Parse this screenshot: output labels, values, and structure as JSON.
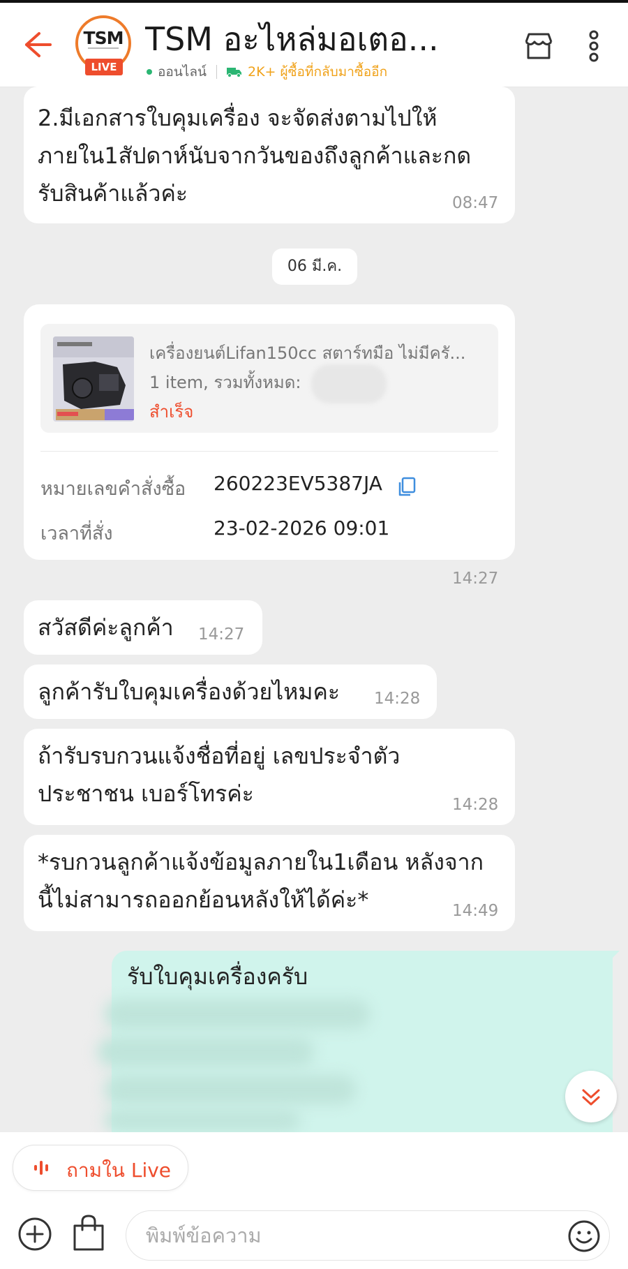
{
  "header": {
    "back_icon": "back-arrow-icon",
    "logo_text": "TSM",
    "live_badge": "LIVE",
    "shop_name": "TSM อะไหล่มอเตอ...",
    "online_status": "ออนไลน์",
    "returning_buyers": "2K+ ผู้ซื้อที่กลับมาซื้ออีก",
    "store_icon": "store-icon",
    "more_icon": "more-vertical-icon"
  },
  "messages": {
    "first": {
      "text": "2.มีเอกสารใบคุมเครื่อง จะจัดส่งตามไปให้\nภายใน1สัปดาห์นับจากวันของถึงลูกค้าและกด\nรับสินค้าแล้วค่ะ",
      "time": "08:47"
    },
    "date_separator": "06 มี.ค.",
    "order_card": {
      "product_name": "เครื่องยนต์Lifan150cc สตาร์ทมือ ไม่มีครั...",
      "items_total": "1 item, รวมทั้งหมด:",
      "status": "สำเร็จ",
      "order_no_label": "หมายเลขคำสั่งซื้อ",
      "order_no": "260223EV5387JA",
      "order_time_label": "เวลาที่สั่ง",
      "order_time": "23-02-2026 09:01",
      "time": "14:27"
    },
    "incoming": [
      {
        "text": "สวัสดีค่ะลูกค้า",
        "time": "14:27"
      },
      {
        "text": "ลูกค้ารับใบคุมเครื่องด้วยไหมคะ",
        "time": "14:28"
      },
      {
        "text": "ถ้ารับรบกวนแจ้งชื่อที่อยู่ เลขประจำตัว\nประชาชน เบอร์โทรค่ะ",
        "time": "14:28"
      },
      {
        "text": "*รบกวนลูกค้าแจ้งข้อมูลภายใน1เดือน หลังจาก\nนี้ไม่สามารถออกย้อนหลังให้ได้ค่ะ*",
        "time": "14:49"
      }
    ],
    "outgoing": {
      "text": "รับใบคุมเครื่องครับ"
    }
  },
  "bottom": {
    "ask_live": "ถามใน Live",
    "input_placeholder": "พิมพ์ข้อความ",
    "plus_icon": "plus-circle-icon",
    "bag_icon": "shopping-bag-icon",
    "emoji_icon": "emoji-icon"
  },
  "colors": {
    "accent": "#ee4d2d",
    "online": "#2bb673",
    "returning": "#f0a21a",
    "outgoing_bubble": "#d0f4ec",
    "background": "#ededed"
  }
}
